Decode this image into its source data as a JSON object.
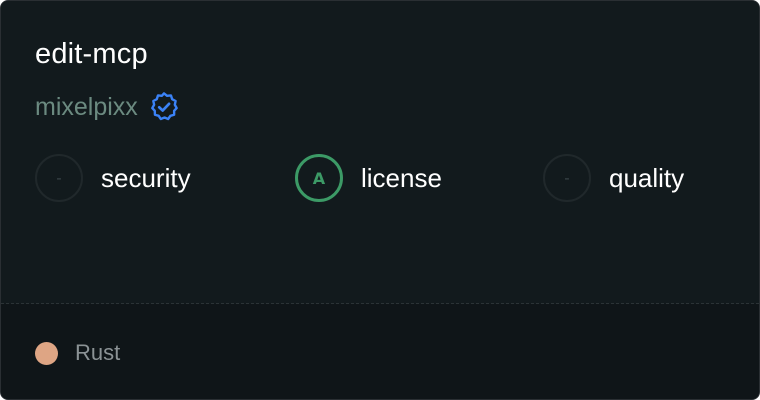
{
  "package": {
    "name": "edit-mcp",
    "owner": "mixelpixx",
    "verified_icon": "verified-badge-icon"
  },
  "metrics": {
    "security": {
      "label": "security",
      "grade": "-"
    },
    "license": {
      "label": "license",
      "grade": "A"
    },
    "quality": {
      "label": "quality",
      "grade": "-"
    }
  },
  "footer": {
    "language": "Rust",
    "language_color": "#dea584"
  },
  "colors": {
    "background": "#121a1d",
    "footer_background": "#0f1518",
    "owner": "#6b8a80",
    "verified": "#3b82f6",
    "grade_a": "#3c9a66",
    "grade_empty_border": "#20282b"
  }
}
